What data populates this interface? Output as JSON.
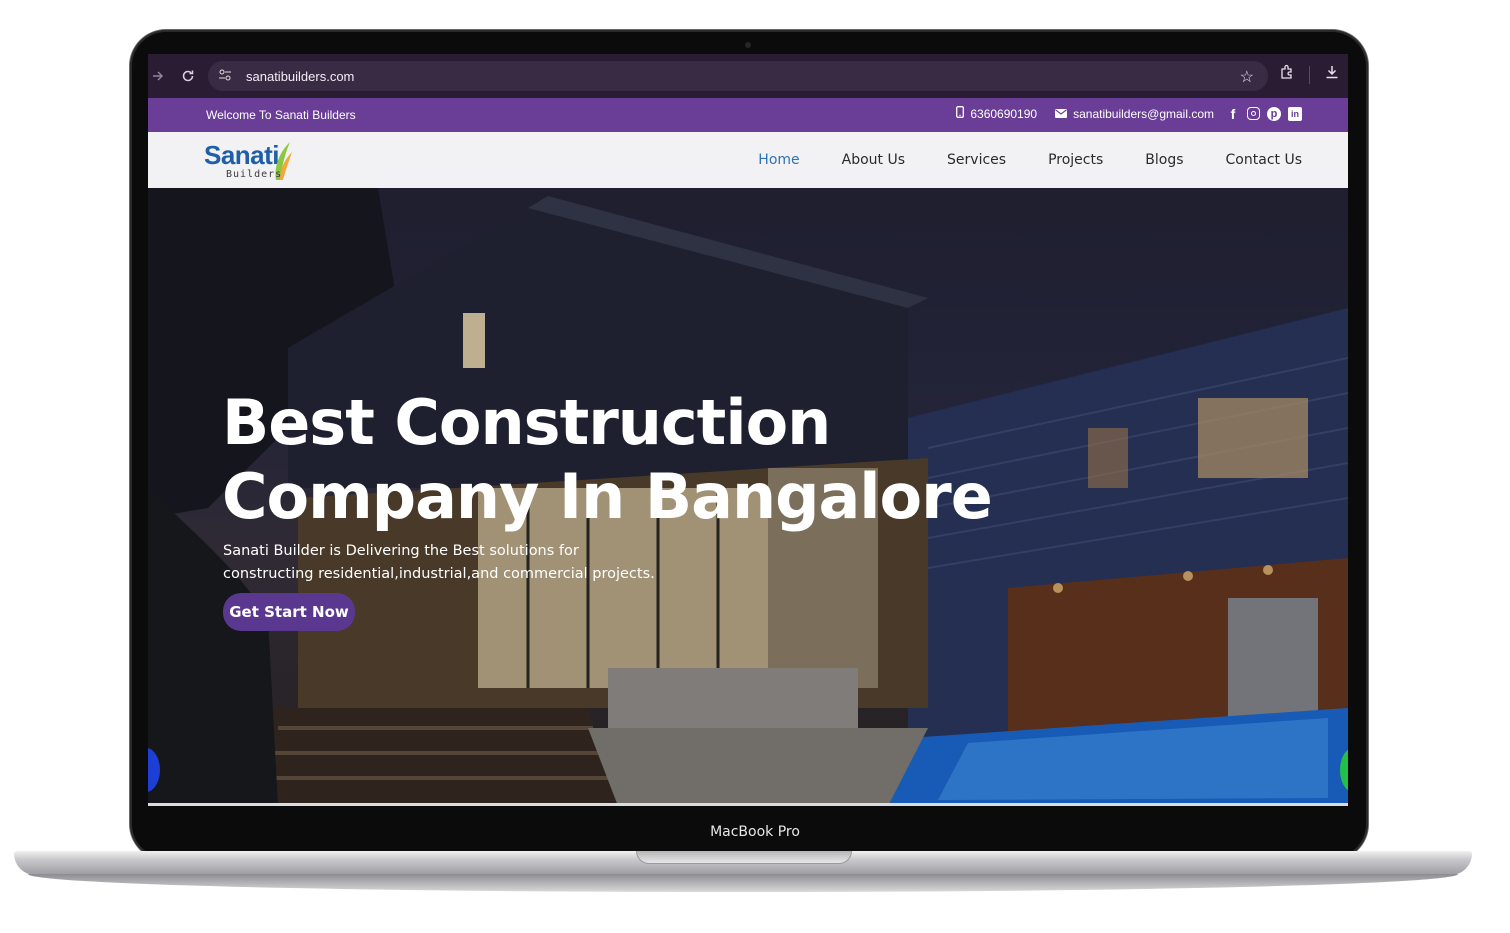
{
  "browser": {
    "url": "sanatibuilders.com",
    "icons": [
      "forward-icon",
      "reload-icon",
      "site-settings-icon",
      "bookmark-star-icon",
      "extensions-icon",
      "download-icon"
    ]
  },
  "topbar": {
    "welcome": "Welcome To Sanati Builders",
    "phone": "6360690190",
    "email": "sanatibuilders@gmail.com",
    "background_color": "#6a3e97"
  },
  "logo": {
    "name": "Sanati",
    "sub": "Builders"
  },
  "nav": {
    "items": [
      {
        "label": "Home",
        "active": true
      },
      {
        "label": "About Us"
      },
      {
        "label": "Services"
      },
      {
        "label": "Projects"
      },
      {
        "label": "Blogs"
      },
      {
        "label": "Contact Us"
      }
    ],
    "active_color": "#2e73b8"
  },
  "hero": {
    "title": "Best Construction Company In Bangalore",
    "subtitle": "Sanati Builder is Delivering the Best solutions for constructing residential,industrial,and commercial projects.",
    "cta": "Get Start Now",
    "cta_color": "#5b3890"
  },
  "device": {
    "label": "MacBook Pro"
  }
}
